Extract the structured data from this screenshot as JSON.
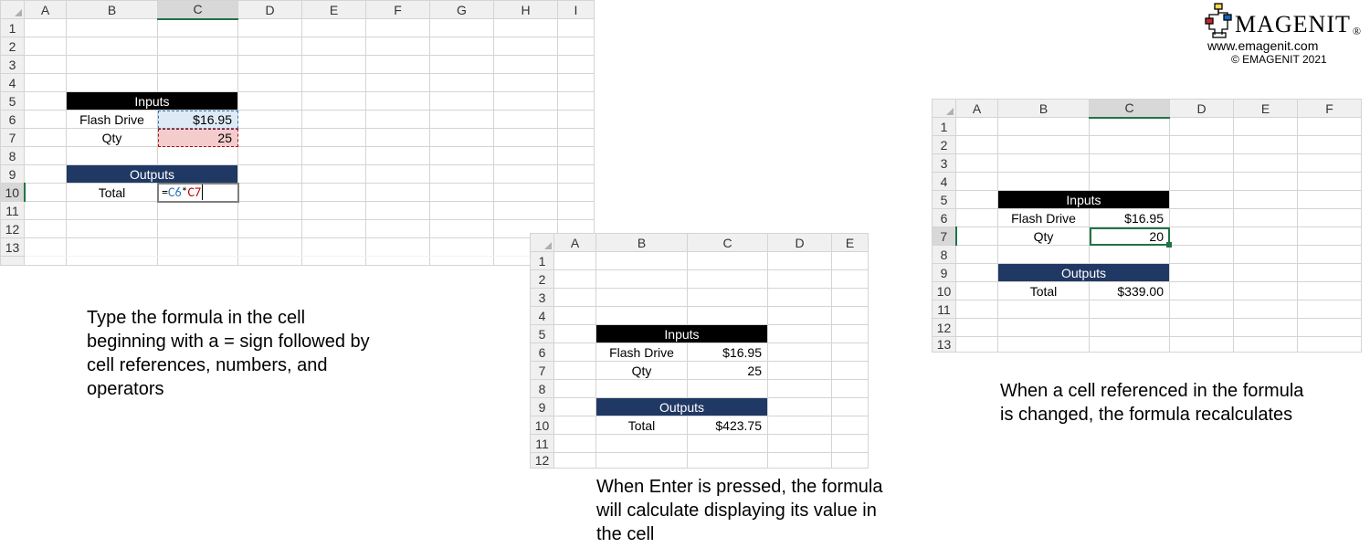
{
  "brand": {
    "name": "MAGENIT",
    "reg": "®",
    "url": "www.emagenit.com",
    "copy": "© EMAGENIT  2021"
  },
  "cols": {
    "A": "A",
    "B": "B",
    "C": "C",
    "D": "D",
    "E": "E",
    "F": "F",
    "G": "G",
    "H": "H",
    "I": "I"
  },
  "labels": {
    "inputs": "Inputs",
    "flash": "Flash Drive",
    "qty": "Qty",
    "outputs": "Outputs",
    "total": "Total"
  },
  "sheet1": {
    "price": "$16.95",
    "qty": "25",
    "formula": {
      "eq": "=",
      "r1": "C6",
      "op": "*",
      "r2": "C7"
    }
  },
  "sheet2": {
    "price": "$16.95",
    "qty": "25",
    "total": "$423.75"
  },
  "sheet3": {
    "price": "$16.95",
    "qty": "20",
    "total": "$339.00"
  },
  "captions": {
    "c1": "Type the formula in the cell beginning with a = sign followed by cell references, numbers, and operators",
    "c2": "When Enter is pressed, the formula will calculate displaying its value in the cell",
    "c3": "When a cell referenced in the formula is changed, the formula recalculates"
  }
}
